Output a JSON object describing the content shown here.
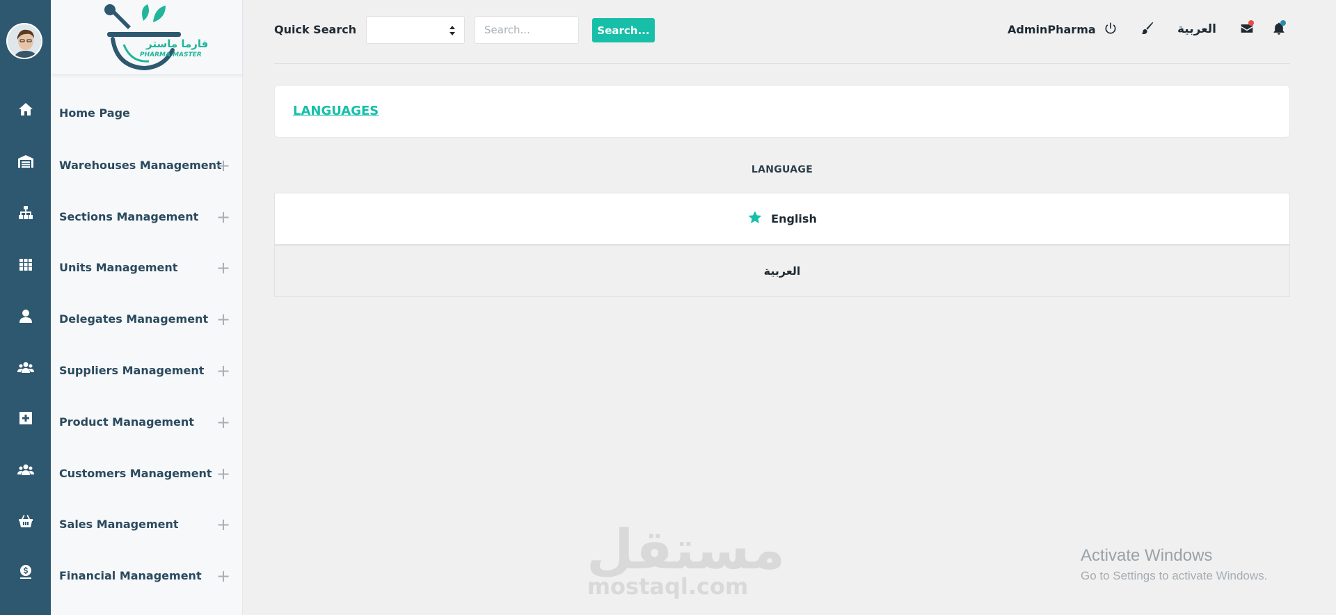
{
  "app": {
    "logo_text_ar": "فارما ماستر",
    "logo_text_en": "PHARMA MASTER"
  },
  "sidebar": {
    "items": [
      {
        "label": "Home Page",
        "icon": "home-icon",
        "expandable": false
      },
      {
        "label": "Warehouses Management",
        "icon": "warehouse-icon",
        "expandable": true
      },
      {
        "label": "Sections Management",
        "icon": "sitemap-icon",
        "expandable": true
      },
      {
        "label": "Units Management",
        "icon": "grid-icon",
        "expandable": true
      },
      {
        "label": "Delegates Management",
        "icon": "user-icon",
        "expandable": true
      },
      {
        "label": "Suppliers Management",
        "icon": "users-icon",
        "expandable": true
      },
      {
        "label": "Product Management",
        "icon": "medical-plus-icon",
        "expandable": true
      },
      {
        "label": "Customers Management",
        "icon": "users-icon",
        "expandable": true
      },
      {
        "label": "Sales Management",
        "icon": "basket-icon",
        "expandable": true
      },
      {
        "label": "Financial Management",
        "icon": "money-icon",
        "expandable": true
      }
    ],
    "expand_symbol": "+"
  },
  "header": {
    "quick_search_label": "Quick Search",
    "search_placeholder": "Search...",
    "search_button": "Search...",
    "select_value": "",
    "admin_name": "AdminPharma",
    "language_switch": "العربية"
  },
  "breadcrumb": {
    "title": "LANGUAGES"
  },
  "languages_table": {
    "header": "LANGUAGE",
    "rows": [
      {
        "name": "English",
        "default": true
      },
      {
        "name": "العربية",
        "default": false
      }
    ]
  },
  "watermarks": {
    "mostaql_ar": "مستقل",
    "mostaql_en": "mostaql.com",
    "activate_title": "Activate Windows",
    "activate_sub": "Go to Settings to activate Windows."
  },
  "colors": {
    "accent": "#17bfa9",
    "rail": "#2d5870",
    "mail_badge": "#e84b4b",
    "bell_badge": "#2a8da8"
  }
}
